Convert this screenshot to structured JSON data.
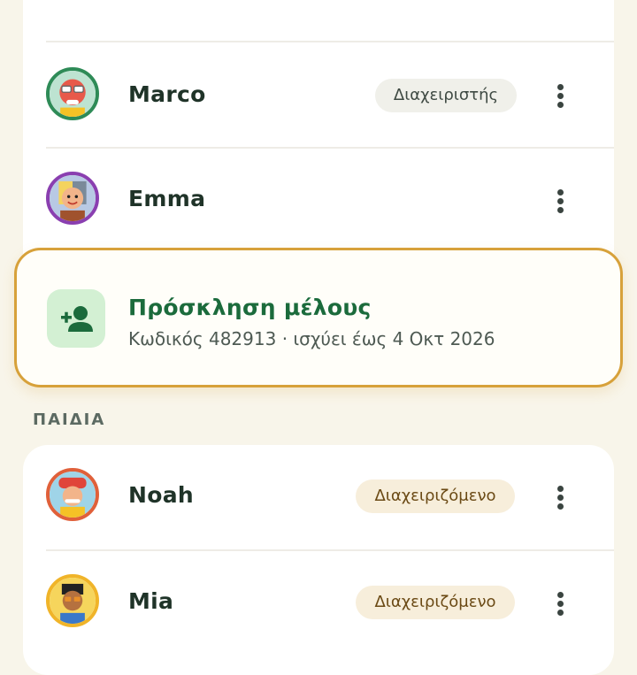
{
  "members_card": {
    "rows": [
      {
        "name": "Marco",
        "role": "Διαχειριστής",
        "avatar": "avatar-marco-icon"
      },
      {
        "name": "Emma",
        "role": "",
        "avatar": "avatar-emma-icon"
      }
    ]
  },
  "invite": {
    "title": "Πρόσκληση μέλους",
    "subtitle": "Κωδικός 482913 · ισχύει έως 4 Οκτ 2026",
    "icon": "add-person-icon"
  },
  "kids_section": {
    "label": "ΠΑΙΔΙΑ",
    "rows": [
      {
        "name": "Noah",
        "role": "Διαχειριζόμενο",
        "avatar": "avatar-noah-icon"
      },
      {
        "name": "Mia",
        "role": "Διαχειριζόμενο",
        "avatar": "avatar-mia-icon"
      }
    ]
  },
  "colors": {
    "background": "#f8f5ea",
    "accent_green": "#1b6b3c",
    "highlight_border": "#d7a13a",
    "admin_chip": "#f0f0ea",
    "managed_chip": "#f7eedb"
  }
}
